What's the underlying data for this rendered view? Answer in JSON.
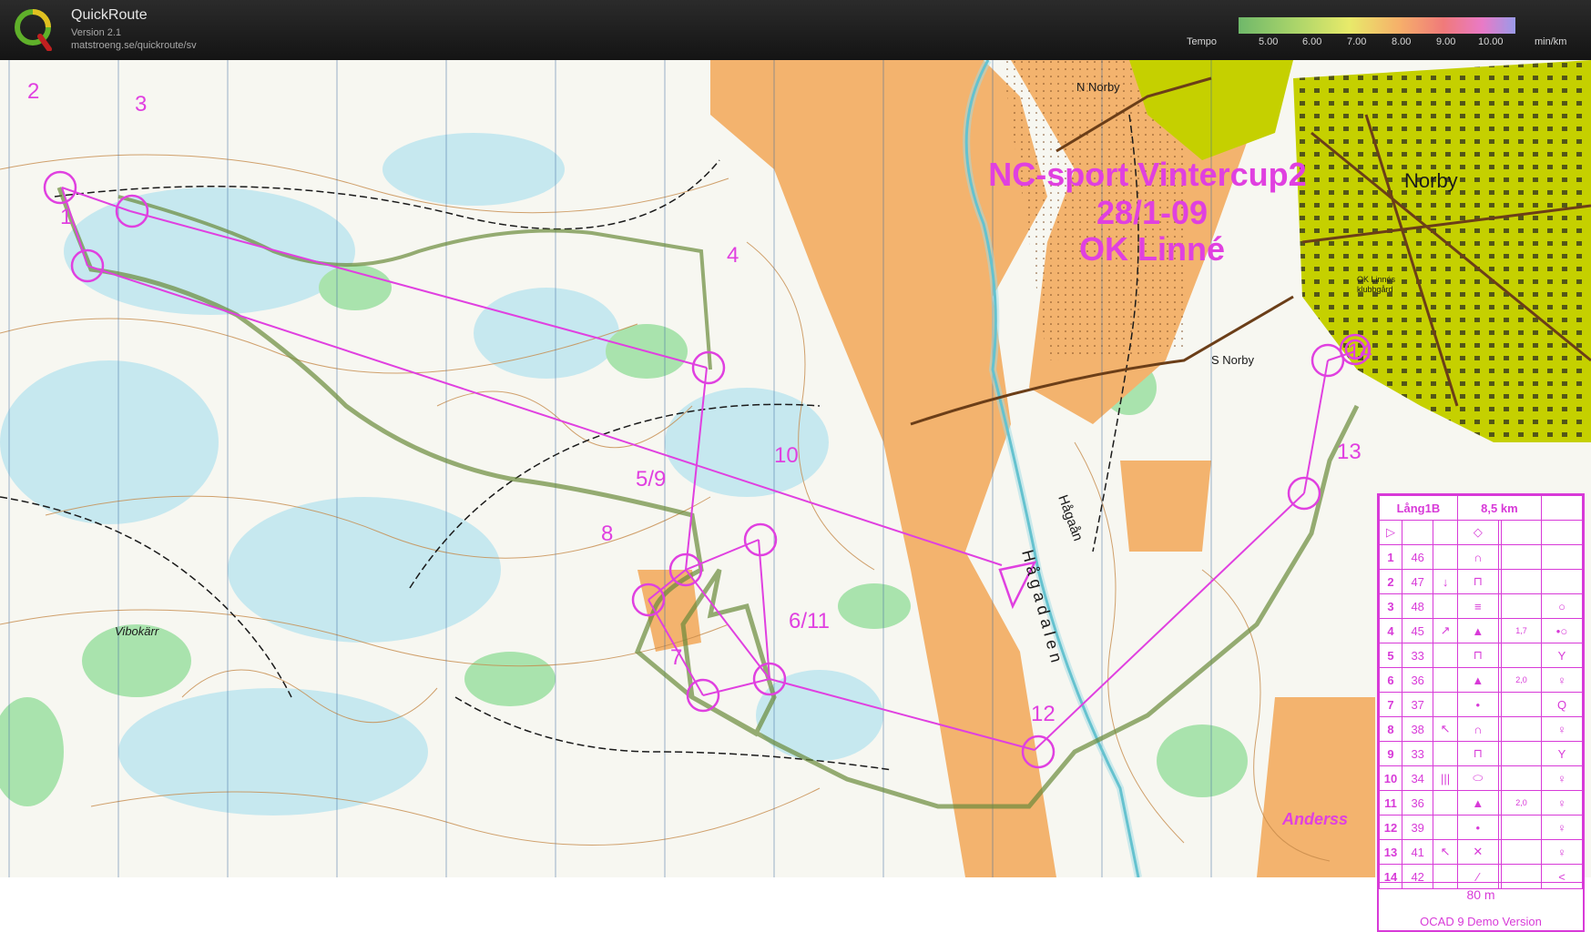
{
  "app": {
    "name": "QuickRoute",
    "version": "Version 2.1",
    "url": "matstroeng.se/quickroute/sv"
  },
  "legend": {
    "title": "Tempo",
    "ticks": [
      "5.00",
      "6.00",
      "7.00",
      "8.00",
      "9.00",
      "10.00"
    ],
    "unit": "min/km"
  },
  "colors": {
    "course": "#e040e0",
    "route": "#6a8a3a",
    "open_land": "#f2b36b",
    "vegetation": "#9fe0a0",
    "water": "#bfe6ef",
    "urban": "#c2d400"
  },
  "map_title": {
    "line1": "NC-sport Vintercup2",
    "line2": "28/1-09",
    "line3": "OK Linné"
  },
  "place_names": {
    "n_norby": "N Norby",
    "norby": "Norby",
    "s_norby": "S Norby",
    "club": "OK Linnés",
    "club2": "klubbgård",
    "hagaan": "Hågaån",
    "hagadalen": "H å g a d a l e n",
    "vibokarr": "Vibokärr",
    "signature": "Anderss"
  },
  "controls": {
    "c1": "1",
    "c2": "2",
    "c3": "3",
    "c4": "4",
    "c59": "5/9",
    "c10": "10",
    "c8": "8",
    "c611": "6/11",
    "c7": "7",
    "c12": "12",
    "c13": "13",
    "c14": "14"
  },
  "description": {
    "course": "Lång1B",
    "length": "8,5 km",
    "rows": [
      {
        "n": "1",
        "code": "46",
        "dir": "",
        "feat": "∩",
        "dim": "",
        "note": ""
      },
      {
        "n": "2",
        "code": "47",
        "dir": "↓",
        "feat": "⊓",
        "dim": "",
        "note": ""
      },
      {
        "n": "3",
        "code": "48",
        "dir": "",
        "feat": "≡",
        "dim": "",
        "note": "○"
      },
      {
        "n": "4",
        "code": "45",
        "dir": "↗",
        "feat": "▲",
        "dim": "1,7",
        "note": "•○"
      },
      {
        "n": "5",
        "code": "33",
        "dir": "",
        "feat": "⊓",
        "dim": "",
        "note": "Y"
      },
      {
        "n": "6",
        "code": "36",
        "dir": "",
        "feat": "▲",
        "dim": "2,0",
        "note": "♀"
      },
      {
        "n": "7",
        "code": "37",
        "dir": "",
        "feat": "•",
        "dim": "",
        "note": "Q"
      },
      {
        "n": "8",
        "code": "38",
        "dir": "↖",
        "feat": "∩",
        "dim": "",
        "note": "♀"
      },
      {
        "n": "9",
        "code": "33",
        "dir": "",
        "feat": "⊓",
        "dim": "",
        "note": "Y"
      },
      {
        "n": "10",
        "code": "34",
        "dir": "|||",
        "feat": "⬭",
        "dim": "",
        "note": "♀"
      },
      {
        "n": "11",
        "code": "36",
        "dir": "",
        "feat": "▲",
        "dim": "2,0",
        "note": "♀"
      },
      {
        "n": "12",
        "code": "39",
        "dir": "",
        "feat": "•",
        "dim": "",
        "note": "♀"
      },
      {
        "n": "13",
        "code": "41",
        "dir": "↖",
        "feat": "✕",
        "dim": "",
        "note": "♀"
      },
      {
        "n": "14",
        "code": "42",
        "dir": "",
        "feat": "⁄",
        "dim": "",
        "note": "<"
      }
    ],
    "finish": "80 m",
    "demo": "OCAD 9 Demo Version"
  }
}
